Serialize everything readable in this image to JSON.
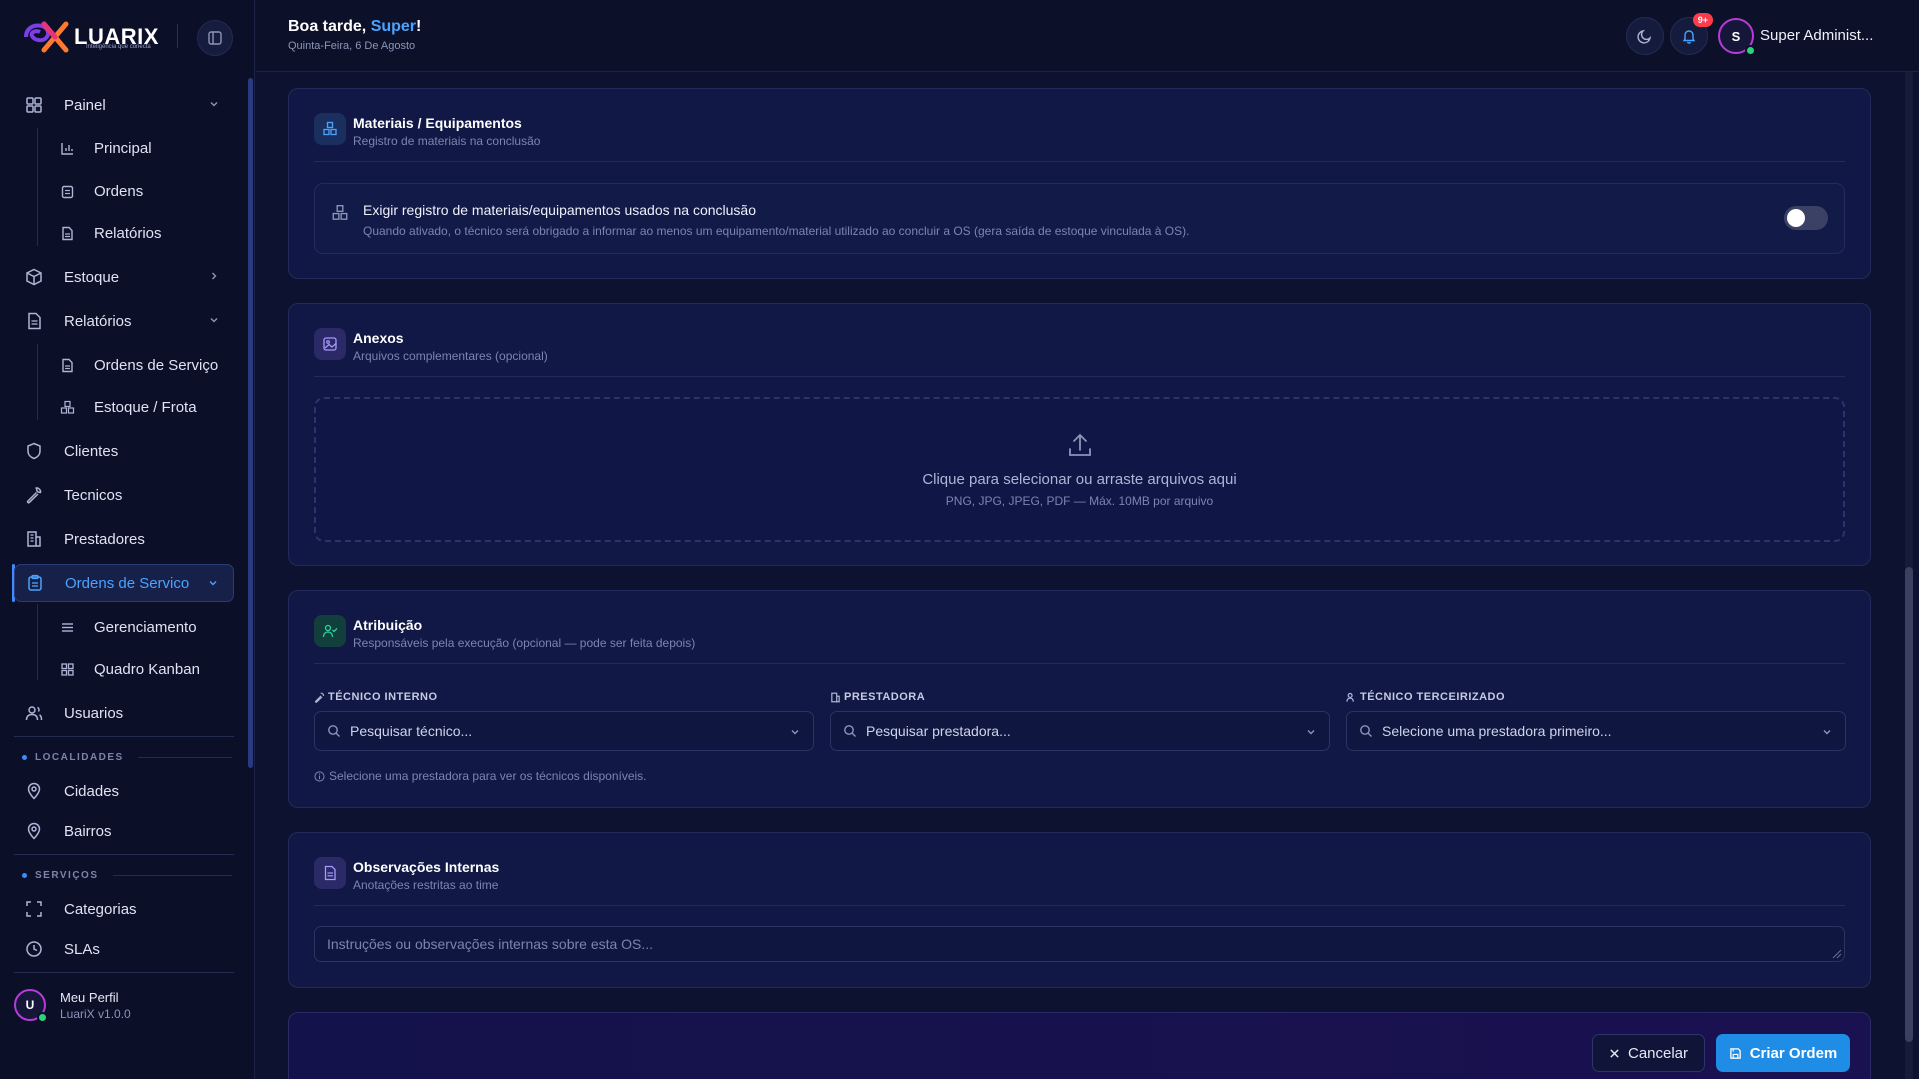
{
  "brand": {
    "name": "LUARIX",
    "tagline": "Inteligência que conecta"
  },
  "header": {
    "greeting_prefix": "Boa tarde, ",
    "greeting_name": "Super",
    "greeting_suffix": "!",
    "date": "Quinta-Feira, 6 De Agosto",
    "notification_badge": "9+",
    "avatar_initial": "S",
    "user_name": "Super Administ..."
  },
  "sidebar": {
    "painel": {
      "label": "Painel",
      "children": [
        "Principal",
        "Ordens",
        "Relatórios"
      ]
    },
    "estoque": {
      "label": "Estoque"
    },
    "relatorios": {
      "label": "Relatórios",
      "children": [
        "Ordens de Serviço",
        "Estoque / Frota"
      ]
    },
    "clientes": {
      "label": "Clientes"
    },
    "tecnicos": {
      "label": "Tecnicos"
    },
    "prestadores": {
      "label": "Prestadores"
    },
    "ordens_servico": {
      "label": "Ordens de Servico",
      "children": [
        "Gerenciamento",
        "Quadro Kanban"
      ]
    },
    "usuarios": {
      "label": "Usuarios"
    },
    "section_localidades": "LOCALIDADES",
    "cidades": {
      "label": "Cidades"
    },
    "bairros": {
      "label": "Bairros"
    },
    "section_servicos": "SERVIÇOS",
    "categorias": {
      "label": "Categorias"
    },
    "slas": {
      "label": "SLAs"
    },
    "profile": {
      "initial": "U",
      "name": "Meu Perfil",
      "version": "LuariX v1.0.0"
    }
  },
  "materiais": {
    "title": "Materiais / Equipamentos",
    "subtitle": "Registro de materiais na conclusão",
    "option_title": "Exigir registro de materiais/equipamentos usados na conclusão",
    "option_desc": "Quando ativado, o técnico será obrigado a informar ao menos um equipamento/material utilizado ao concluir a OS (gera saída de estoque vinculada à OS).",
    "toggle_on": false
  },
  "anexos": {
    "title": "Anexos",
    "subtitle": "Arquivos complementares (opcional)",
    "drop_text": "Clique para selecionar ou arraste arquivos aqui",
    "drop_hint": "PNG, JPG, JPEG, PDF — Máx. 10MB por arquivo"
  },
  "atribuicao": {
    "title": "Atribuição",
    "subtitle": "Responsáveis pela execução (opcional — pode ser feita depois)",
    "fields": [
      {
        "label": "TÉCNICO INTERNO",
        "placeholder": "Pesquisar técnico..."
      },
      {
        "label": "PRESTADORA",
        "placeholder": "Pesquisar prestadora..."
      },
      {
        "label": "TÉCNICO TERCEIRIZADO",
        "placeholder": "Selecione uma prestadora primeiro..."
      }
    ],
    "hint": "Selecione uma prestadora para ver os técnicos disponíveis."
  },
  "observacoes": {
    "title": "Observações Internas",
    "subtitle": "Anotações restritas ao time",
    "placeholder": "Instruções ou observações internas sobre esta OS..."
  },
  "actions": {
    "cancel": "Cancelar",
    "create": "Criar Ordem"
  },
  "colors": {
    "accent": "#1f8ce6",
    "highlight": "#4aa3ff",
    "badge": "#ff3b4a",
    "online": "#2bd47a",
    "background": "#0d1230"
  }
}
